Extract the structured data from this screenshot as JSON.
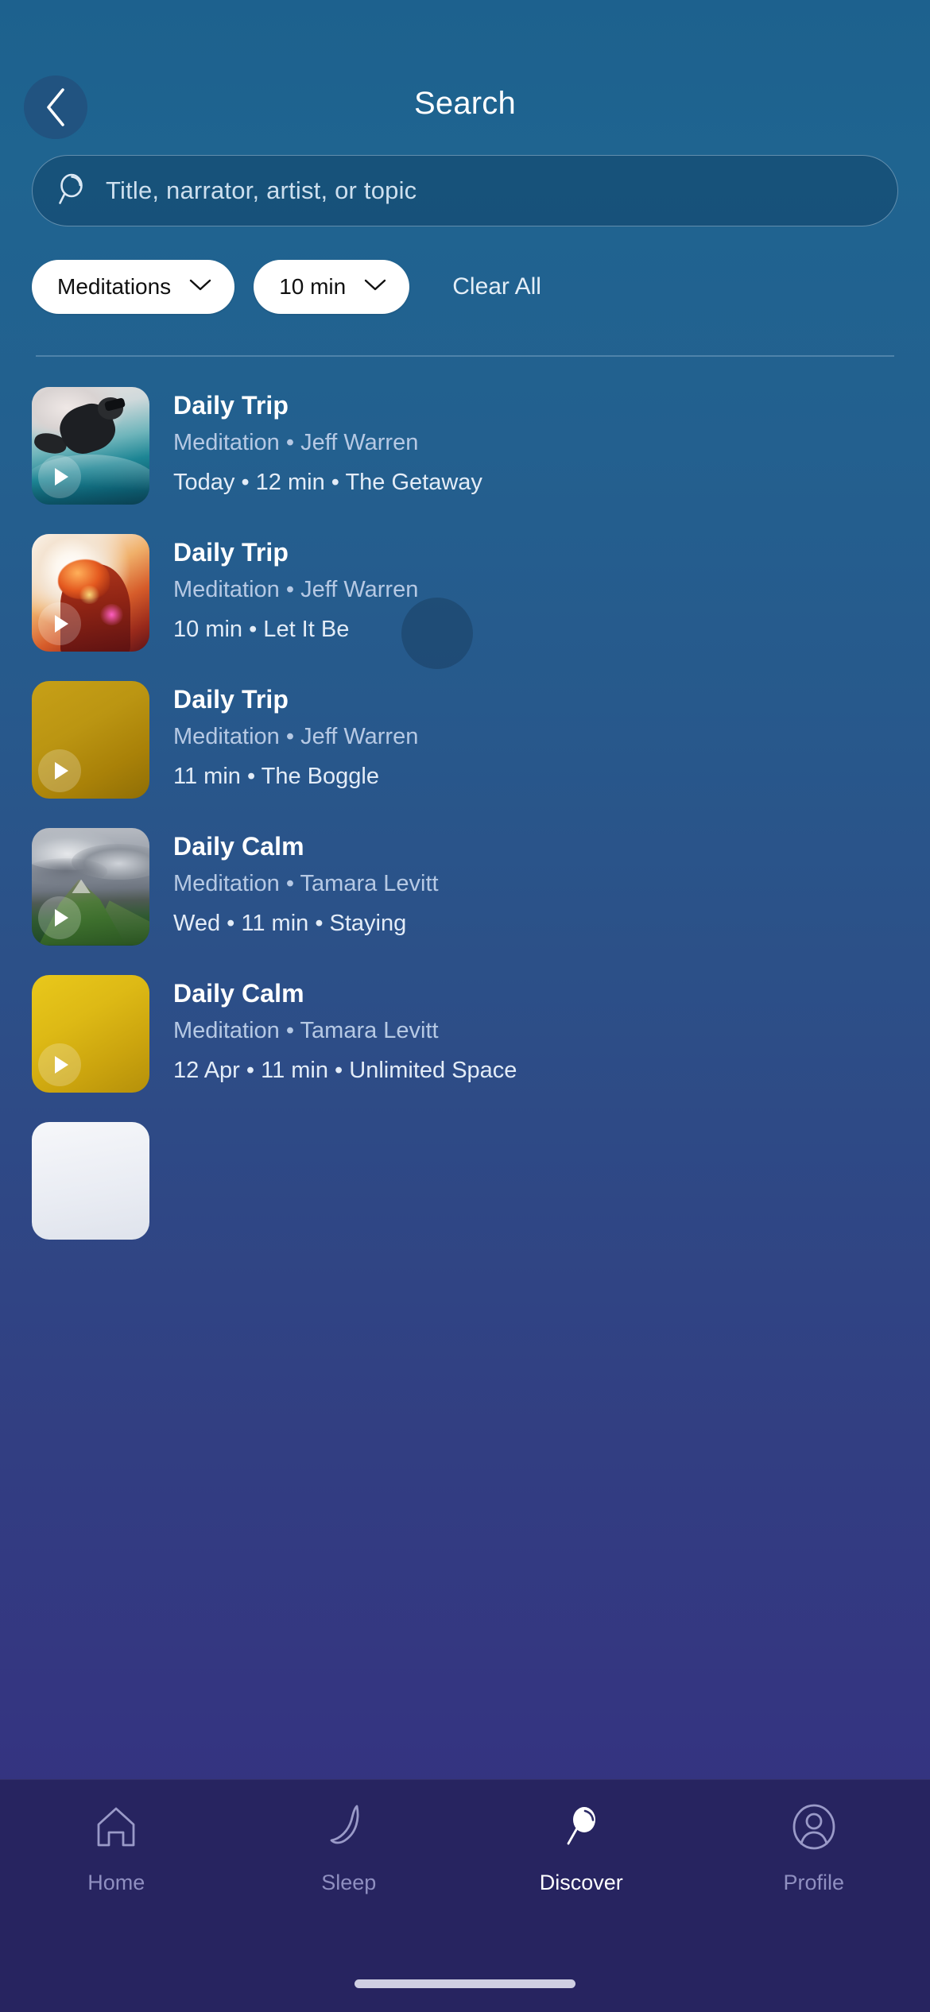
{
  "header": {
    "title": "Search",
    "back_icon": "chevron-left-icon"
  },
  "search": {
    "placeholder": "Title, narrator, artist, or topic",
    "value": "",
    "icon": "search-icon"
  },
  "filters": {
    "chips": [
      {
        "label": "Meditations",
        "icon": "chevron-down-icon"
      },
      {
        "label": "10 min",
        "icon": "chevron-down-icon"
      }
    ],
    "clear_all_label": "Clear All"
  },
  "results": [
    {
      "title": "Daily Trip",
      "subtitle": "Meditation • Jeff Warren",
      "details": "Today • 12 min • The Getaway",
      "thumb": "surfer-underwater",
      "play_icon": "play-icon"
    },
    {
      "title": "Daily Trip",
      "subtitle": "Meditation • Jeff Warren",
      "details": "10 min • Let It Be",
      "thumb": "person-sunset",
      "play_icon": "play-icon"
    },
    {
      "title": "Daily Trip",
      "subtitle": "Meditation • Jeff Warren",
      "details": "11 min • The Boggle",
      "thumb": "gold-gradient",
      "play_icon": "play-icon"
    },
    {
      "title": "Daily Calm",
      "subtitle": "Meditation • Tamara Levitt",
      "details": "Wed • 11 min • Staying",
      "thumb": "mountain-clouds",
      "play_icon": "play-icon"
    },
    {
      "title": "Daily Calm",
      "subtitle": "Meditation • Tamara Levitt",
      "details": "12 Apr • 11 min • Unlimited Space",
      "thumb": "yellow-gradient",
      "play_icon": "play-icon"
    }
  ],
  "bottom_nav": {
    "items": [
      {
        "label": "Home",
        "icon": "home-icon",
        "active": false
      },
      {
        "label": "Sleep",
        "icon": "moon-icon",
        "active": false
      },
      {
        "label": "Discover",
        "icon": "search-icon",
        "active": true
      },
      {
        "label": "Profile",
        "icon": "person-icon",
        "active": false
      }
    ]
  },
  "colors": {
    "bg_top": "#1F6490",
    "bg_bottom": "#343180",
    "nav_bg": "#272460",
    "chip_bg": "#FFFFFF",
    "chip_text": "#101010",
    "accent_text": "#FFFFFF",
    "muted_text": "#B6C9E4",
    "nav_inactive": "#8F8FC0"
  }
}
